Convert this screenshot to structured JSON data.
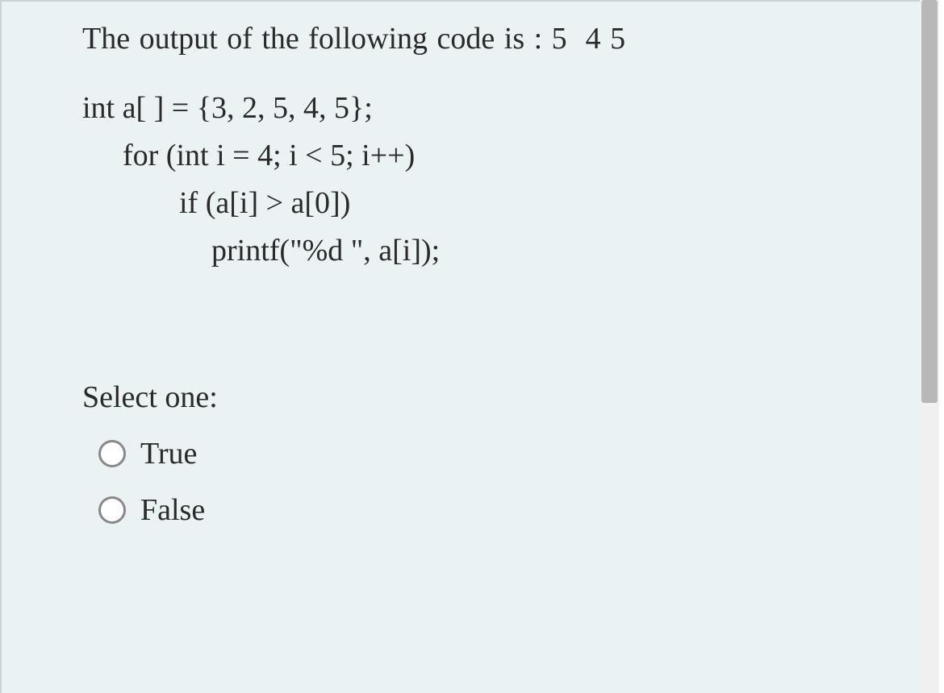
{
  "question": {
    "prompt": "The output of the following code is : 5  4 5",
    "code_lines": [
      "int a[ ] = {3, 2, 5, 4, 5};",
      "for (int i = 4; i < 5; i++)",
      "if (a[i] > a[0])",
      "printf(\"%d \", a[i]);"
    ],
    "select_prompt": "Select one:",
    "options": [
      {
        "label": "True"
      },
      {
        "label": "False"
      }
    ]
  }
}
